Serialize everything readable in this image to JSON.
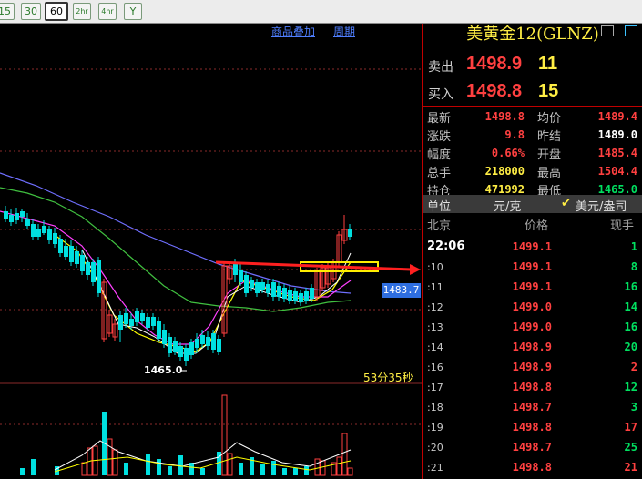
{
  "toolbar": {
    "periods": [
      "15",
      "30",
      "60",
      "2hr",
      "4hr",
      "Y"
    ],
    "active_period": "60"
  },
  "chart": {
    "links": [
      "商品叠加",
      "周期"
    ],
    "price_tag": "1483.7",
    "low_marker": "1465.0",
    "countdown": "53分35秒",
    "colors": {
      "up": "#ff4040",
      "down": "#00e0e0",
      "ma_white": "#ffffff",
      "ma_yellow": "#ffff00",
      "ma_magenta": "#ff40ff",
      "ma_green": "#40c040",
      "ma_blue": "#6f6fff"
    }
  },
  "quote": {
    "title": "美黄金12(GLNZ)",
    "sell": {
      "label": "卖出",
      "price": "1498.9",
      "volume": "11"
    },
    "buy": {
      "label": "买入",
      "price": "1498.8",
      "volume": "15"
    },
    "stats": [
      {
        "l1": "最新",
        "v1": "1498.8",
        "l2": "均价",
        "v2": "1489.4"
      },
      {
        "l1": "涨跌",
        "v1": "9.8",
        "l2": "昨结",
        "v2": "1489.0"
      },
      {
        "l1": "幅度",
        "v1": "0.66%",
        "l2": "开盘",
        "v2": "1485.4"
      },
      {
        "l1": "总手",
        "v1": "218000",
        "l2": "最高",
        "v2": "1504.4"
      },
      {
        "l1": "持仓",
        "v1": "471992",
        "l2": "最低",
        "v2": "1465.0"
      }
    ],
    "unit": {
      "label": "单位",
      "value": "元/克",
      "alt": "美元/盎司"
    }
  },
  "ticks": {
    "headers": [
      "北京",
      "价格",
      "现手"
    ],
    "rows": [
      {
        "time": "22:06",
        "price": "1499.1",
        "vol": "1"
      },
      {
        "time": ":10",
        "price": "1499.1",
        "vol": "8"
      },
      {
        "time": ":11",
        "price": "1499.1",
        "vol": "16"
      },
      {
        "time": ":12",
        "price": "1499.0",
        "vol": "14"
      },
      {
        "time": ":13",
        "price": "1499.0",
        "vol": "16"
      },
      {
        "time": ":14",
        "price": "1498.9",
        "vol": "20"
      },
      {
        "time": ":16",
        "price": "1498.9",
        "vol": "2"
      },
      {
        "time": ":17",
        "price": "1498.8",
        "vol": "12"
      },
      {
        "time": ":18",
        "price": "1498.7",
        "vol": "3"
      },
      {
        "time": ":19",
        "price": "1498.8",
        "vol": "17"
      },
      {
        "time": ":20",
        "price": "1498.7",
        "vol": "25"
      },
      {
        "time": ":21",
        "price": "1498.8",
        "vol": "21"
      }
    ]
  }
}
